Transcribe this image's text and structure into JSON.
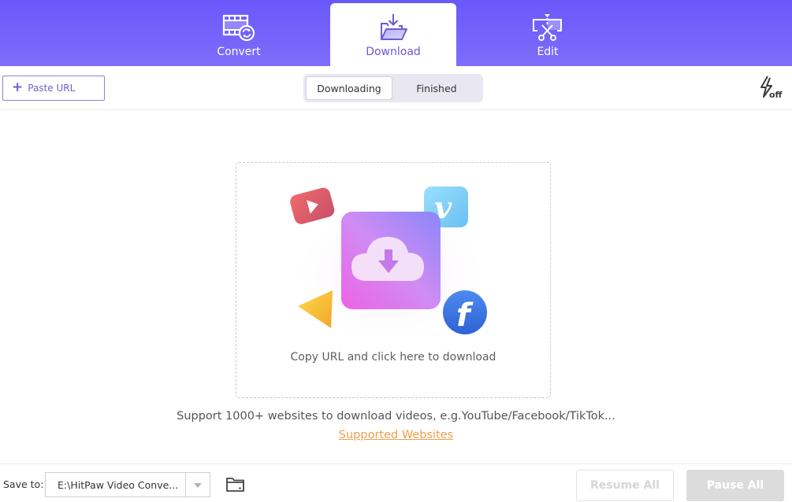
{
  "header": {
    "tabs": [
      {
        "id": "convert",
        "label": "Convert",
        "icon": "film-convert-icon",
        "active": false
      },
      {
        "id": "download",
        "label": "Download",
        "icon": "folder-download-icon",
        "active": true
      },
      {
        "id": "edit",
        "label": "Edit",
        "icon": "scissors-cut-icon",
        "active": false
      }
    ],
    "colors": {
      "gradient_top": "#6a58fb",
      "gradient_bottom": "#7f6dfb",
      "active_label": "#6a5bd6"
    }
  },
  "toolbar": {
    "paste_url_label": "Paste URL",
    "paste_url_icon": "plus-icon",
    "segments": [
      {
        "label": "Downloading",
        "selected": true
      },
      {
        "label": "Finished",
        "selected": false
      }
    ],
    "turbo_icon": "lightning-off-icon",
    "turbo_state": "off"
  },
  "dropzone": {
    "instruction": "Copy URL and click here to download",
    "illustration_icons": [
      "youtube-icon",
      "vimeo-icon",
      "cloud-download-icon",
      "facebook-icon",
      "triangle-icon"
    ]
  },
  "support": {
    "text": "Support 1000+ websites to download videos, e.g.YouTube/Facebook/TikTok...",
    "link_label": "Supported Websites",
    "link_color": "#f0a04b"
  },
  "footer": {
    "save_to_label": "Save to:",
    "save_path": "E:\\HitPaw Video Conve...",
    "resume_all_label": "Resume All",
    "pause_all_label": "Pause All",
    "resume_enabled": false,
    "pause_enabled": false
  }
}
